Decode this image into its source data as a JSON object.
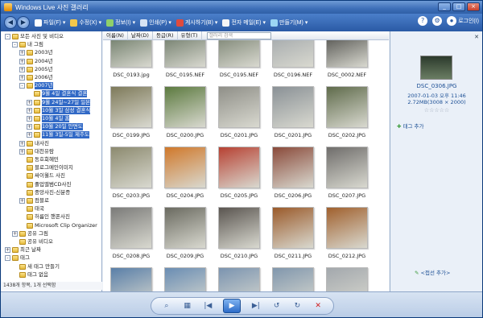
{
  "window": {
    "title": "Windows Live 사진 갤러리"
  },
  "toolbar": {
    "items": [
      {
        "label": "파일(F)",
        "icon": "file-icon",
        "color": "#ffffff"
      },
      {
        "label": "수정(X)",
        "icon": "edit-icon",
        "color": "#f4c84a"
      },
      {
        "label": "정보(I)",
        "icon": "info-icon",
        "color": "#8fd06a"
      },
      {
        "label": "인쇄(P)",
        "icon": "print-icon",
        "color": "#d8e4f4"
      },
      {
        "label": "게시하기(B)",
        "icon": "publish-icon",
        "color": "#e04b3d"
      },
      {
        "label": "전자 메일(E)",
        "icon": "email-icon",
        "color": "#f6f6f6"
      },
      {
        "label": "만들기(M)",
        "icon": "make-icon",
        "color": "#9bd6f3"
      }
    ],
    "right": {
      "help": "?",
      "settings": "⚙",
      "login": "로그인(I)"
    }
  },
  "tree": {
    "rows": [
      {
        "label": "모든 사진 및 비디오",
        "level": 0,
        "toggle": "-",
        "selected": false
      },
      {
        "label": "내 그림",
        "level": 1,
        "toggle": "-",
        "selected": false
      },
      {
        "label": "2003년",
        "level": 2,
        "toggle": "+",
        "selected": false
      },
      {
        "label": "2004년",
        "level": 2,
        "toggle": "+",
        "selected": false
      },
      {
        "label": "2005년",
        "level": 2,
        "toggle": "+",
        "selected": false
      },
      {
        "label": "2006년",
        "level": 2,
        "toggle": "+",
        "selected": false
      },
      {
        "label": "2007년",
        "level": 2,
        "toggle": "-",
        "selected": true
      },
      {
        "label": "9월 4일 결혼식 결혼",
        "level": 3,
        "toggle": "",
        "selected": true
      },
      {
        "label": "9월 24일~27일 일본",
        "level": 3,
        "toggle": "+",
        "selected": true
      },
      {
        "label": "10월 3일 삼성 결혼식",
        "level": 3,
        "toggle": "+",
        "selected": true
      },
      {
        "label": "10월 4일 홈",
        "level": 3,
        "toggle": "+",
        "selected": true
      },
      {
        "label": "10월 20일 안면도",
        "level": 3,
        "toggle": "+",
        "selected": true
      },
      {
        "label": "11월 3일-5일 제주도",
        "level": 3,
        "toggle": "+",
        "selected": true
      },
      {
        "label": "내사진",
        "level": 2,
        "toggle": "+",
        "selected": false
      },
      {
        "label": "대천유람",
        "level": 2,
        "toggle": "+",
        "selected": false
      },
      {
        "label": "동호회혜민",
        "level": 2,
        "toggle": "",
        "selected": false
      },
      {
        "label": "블로그메인이미지",
        "level": 2,
        "toggle": "",
        "selected": false
      },
      {
        "label": "싸이월드 사진",
        "level": 2,
        "toggle": "",
        "selected": false
      },
      {
        "label": "졸업앨범CD사진",
        "level": 2,
        "toggle": "",
        "selected": false
      },
      {
        "label": "중앙사진-신분증",
        "level": 2,
        "toggle": "",
        "selected": false
      },
      {
        "label": "컴블로",
        "level": 2,
        "toggle": "+",
        "selected": false
      },
      {
        "label": "태국",
        "level": 2,
        "toggle": "",
        "selected": false
      },
      {
        "label": "허름인 핸폰사진",
        "level": 2,
        "toggle": "",
        "selected": false
      },
      {
        "label": "Microsoft Clip Organizer",
        "level": 2,
        "toggle": "",
        "selected": false
      },
      {
        "label": "공유 그림",
        "level": 1,
        "toggle": "+",
        "selected": false
      },
      {
        "label": "공유 비디오",
        "level": 1,
        "toggle": "",
        "selected": false
      },
      {
        "label": "최근 날짜",
        "level": 0,
        "toggle": "+",
        "selected": false
      },
      {
        "label": "태그",
        "level": 0,
        "toggle": "-",
        "selected": false
      },
      {
        "label": "새 태그 만들기",
        "level": 1,
        "toggle": "",
        "selected": false
      },
      {
        "label": "태그 없음",
        "level": 1,
        "toggle": "",
        "selected": false
      }
    ],
    "status": "1438개 항목, 1개 선택함"
  },
  "header": {
    "columns": [
      "이름(N)",
      "날짜(D)",
      "등급(R)",
      "유형(T)"
    ],
    "search_placeholder": "갤러리 검색"
  },
  "grid": {
    "items": [
      {
        "name": "DSC_0193.jpg",
        "tone": "#5a6a55"
      },
      {
        "name": "DSC_0195.NEF",
        "tone": "#5d6b58"
      },
      {
        "name": "DSC_0195.NEF",
        "tone": "#6b7563"
      },
      {
        "name": "DSC_0196.NEF",
        "tone": "#9aa0a5"
      },
      {
        "name": "DSC_0002.NEF",
        "tone": "#3b3b38"
      },
      {
        "name": "DSC_0199.JPG",
        "tone": "#7e7a5a"
      },
      {
        "name": "DSC_0200.JPG",
        "tone": "#5c7a3f"
      },
      {
        "name": "DSC_0201.JPG",
        "tone": "#8f8f88"
      },
      {
        "name": "DSC_0201.JPG",
        "tone": "#8a9196"
      },
      {
        "name": "DSC_0202.JPG",
        "tone": "#5f6b4b"
      },
      {
        "name": "DSC_0203.JPG",
        "tone": "#8c8a6f"
      },
      {
        "name": "DSC_0204.JPG",
        "tone": "#d0782a"
      },
      {
        "name": "DSC_0205.JPG",
        "tone": "#b74132"
      },
      {
        "name": "DSC_0206.JPG",
        "tone": "#8a4a3a"
      },
      {
        "name": "DSC_0207.JPG",
        "tone": "#6f6d6b"
      },
      {
        "name": "DSC_0208.JPG",
        "tone": "#7b7b79"
      },
      {
        "name": "DSC_0209.JPG",
        "tone": "#6a6a60"
      },
      {
        "name": "DSC_0210.JPG",
        "tone": "#5a5550"
      },
      {
        "name": "DSC_0211.JPG",
        "tone": "#9a5a2a"
      },
      {
        "name": "DSC_0212.JPG",
        "tone": "#a0602d"
      },
      {
        "name": "",
        "tone": "#5a7fa8"
      },
      {
        "name": "",
        "tone": "#6a8db3"
      },
      {
        "name": "",
        "tone": "#7b94b0"
      },
      {
        "name": "",
        "tone": "#8197ad"
      },
      {
        "name": "",
        "tone": "#a3a8ad"
      }
    ]
  },
  "info": {
    "filename": "DSC_0306.JPG",
    "date": "2007-01-03   오후 11:46",
    "size": "2.72MB(3008 × 2000)",
    "rating": "☆☆☆☆☆",
    "add_tag": "태그 추가",
    "collapse": "<접선 추가>"
  },
  "controls": {
    "zoom": "⌕",
    "view": "▦",
    "prev": "|◀",
    "slideshow": "▶",
    "next": "▶|",
    "rotate_left": "↺",
    "rotate_right": "↻",
    "delete": "✕"
  }
}
